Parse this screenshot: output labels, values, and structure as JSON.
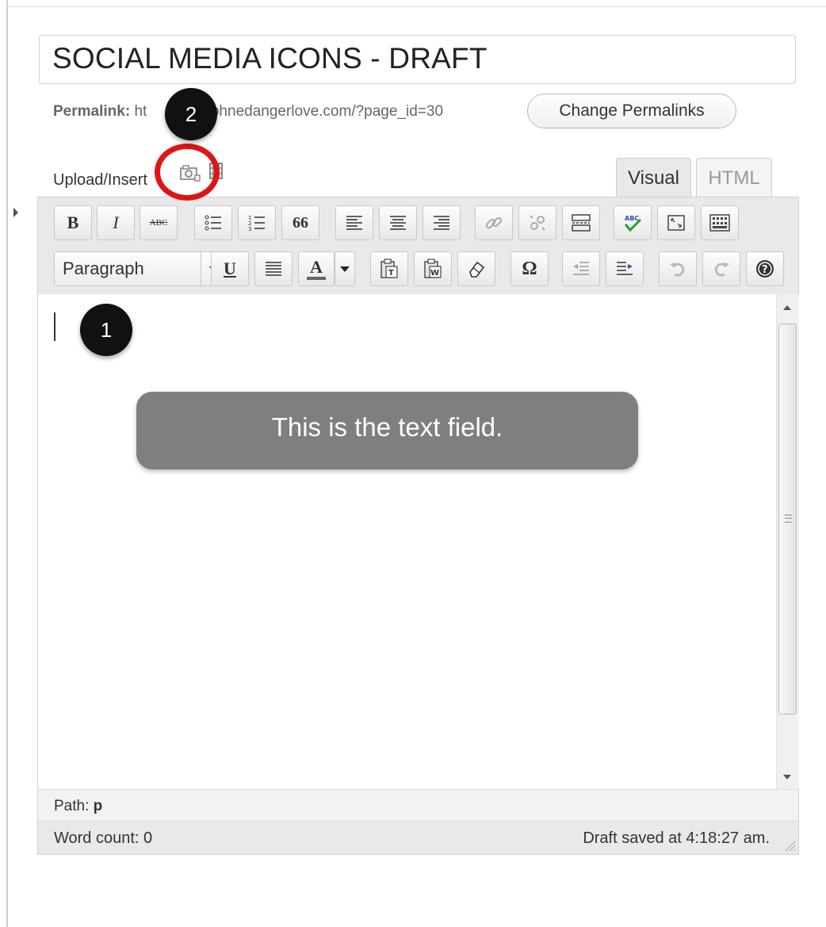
{
  "post": {
    "title": "SOCIAL MEDIA ICONS - DRAFT",
    "permalink_label": "Permalink:",
    "permalink_prefix": "ht",
    "permalink_suffix": "aphnedangerlove.com/?page_id=30",
    "change_permalinks_label": "Change Permalinks"
  },
  "media": {
    "upload_insert_label": "Upload/Insert",
    "icons": [
      "add-image-icon",
      "add-video-icon"
    ]
  },
  "tabs": {
    "visual": "Visual",
    "html": "HTML"
  },
  "toolbar": {
    "row1": [
      "bold",
      "italic",
      "strikethrough",
      "bulleted-list",
      "numbered-list",
      "blockquote",
      "align-left",
      "align-center",
      "align-right",
      "insert-link",
      "unlink",
      "insert-more-tag",
      "spellcheck",
      "fullscreen",
      "show-kitchen-sink"
    ],
    "bold_glyph": "B",
    "italic_glyph": "I",
    "strike_glyph": "ABC",
    "quote_glyph": "66",
    "format_select": "Paragraph",
    "underline_glyph": "U",
    "textcolor_glyph": "A",
    "omega_glyph": "Ω"
  },
  "footer": {
    "path_label": "Path:",
    "path_value": "p",
    "word_count": "Word count: 0",
    "draft_saved": "Draft saved at 4:18:27 am."
  },
  "annotations": {
    "callout_text": "This is the text field.",
    "marker_1": "1",
    "marker_2": "2",
    "ring_color": "#e01414"
  }
}
